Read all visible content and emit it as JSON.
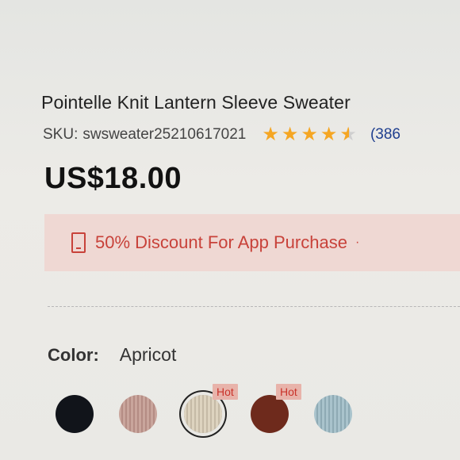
{
  "product": {
    "title": "Pointelle Knit Lantern Sleeve Sweater",
    "sku_label": "SKU:",
    "sku_value": "swsweater25210617021",
    "rating": 4.5,
    "review_count_text": "(386",
    "price": "US$18.00"
  },
  "promo": {
    "icon": "phone-icon",
    "text": "50% Discount For App Purchase",
    "suffix": "·",
    "color": "#c8423a",
    "background": "#efd8d3"
  },
  "color_selector": {
    "label": "Color:",
    "selected_value": "Apricot",
    "swatches": [
      {
        "name": "black",
        "color": "#11141a",
        "hot": false,
        "selected": false
      },
      {
        "name": "pink",
        "color": "#c9a59c",
        "hot": false,
        "selected": false
      },
      {
        "name": "apricot",
        "color": "#ddd3bf",
        "hot": true,
        "selected": true
      },
      {
        "name": "brown",
        "color": "#6e2a1c",
        "hot": true,
        "selected": false
      },
      {
        "name": "blue",
        "color": "#a9c3cc",
        "hot": false,
        "selected": false
      }
    ],
    "hot_label": "Hot"
  },
  "colors": {
    "star": "#f5a623",
    "review_link": "#1f3f8f",
    "hot_tag_text": "#c9332a"
  }
}
